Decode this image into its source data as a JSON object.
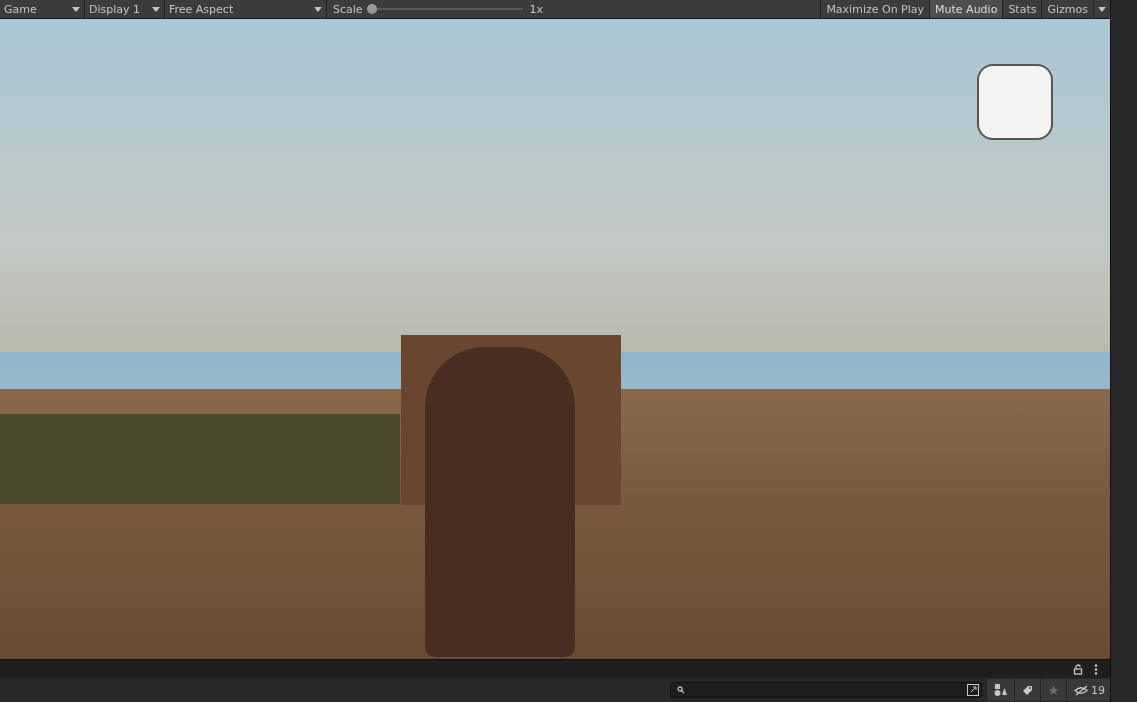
{
  "toolbar": {
    "view_dropdown": "Game",
    "display_dropdown": "Display 1",
    "aspect_dropdown": "Free Aspect",
    "scale": {
      "label": "Scale",
      "level": 0.0,
      "reading": "1x"
    },
    "toggles": [
      {
        "label": "Maximize On Play",
        "selected": false
      },
      {
        "label": "Mute Audio",
        "selected": true
      },
      {
        "label": "Stats",
        "selected": false
      },
      {
        "label": "Gizmos",
        "selected": false
      }
    ]
  },
  "bottom_bar": {
    "hidden_count": "19"
  }
}
